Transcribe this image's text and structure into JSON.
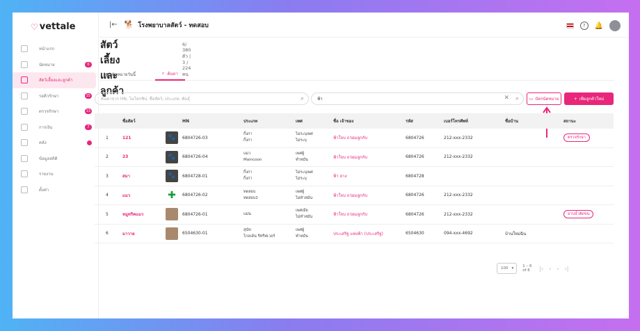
{
  "brand": {
    "name": "vettale"
  },
  "sidebar": {
    "items": [
      {
        "label": "หน้าแรก",
        "badge": ""
      },
      {
        "label": "นัดหมาย",
        "badge": "0"
      },
      {
        "label": "สัตว์เลี้ยงและลูกค้า",
        "badge": ""
      },
      {
        "label": "รอคิวรักษา",
        "badge": "15"
      },
      {
        "label": "ตรวจรักษา",
        "badge": "13"
      },
      {
        "label": "การเงิน",
        "badge": "7"
      },
      {
        "label": "คลัง",
        "badge": "dot"
      },
      {
        "label": "ข้อมูลสถิติ",
        "badge": ""
      },
      {
        "label": "รายงาน",
        "badge": ""
      },
      {
        "label": "ตั้งค่า",
        "badge": ""
      }
    ]
  },
  "topbar": {
    "clinic_name": "โรงพยาบาลสัตว์ - ทดสอบ"
  },
  "page": {
    "title": "สัตว์เลี้ยงและลูกค้า",
    "pet_count": "6/ 380 ตัว",
    "customer_count": "3 / 224 คน"
  },
  "tabs": [
    {
      "label": "นัดหมายวันนี้"
    },
    {
      "label": "ค้นหา"
    }
  ],
  "search": {
    "placeholder": "ค้นหาจาก HN, ไมโครชิป, ชื่อสัตว์, ประเภท, พันธุ์",
    "owner_value": "ฟ้า"
  },
  "buttons": {
    "print": "บัตรนัดหมาย",
    "add": "เพิ่มลูกค้าใหม่"
  },
  "table": {
    "headers": {
      "name": "ชื่อสัตว์",
      "hn": "HN",
      "type": "ประเภท",
      "sex": "เพศ",
      "owner": "ชื่อ เจ้าของ",
      "code": "รหัส",
      "phone": "เบอร์โทรศัพท์",
      "house": "ชื่อบ้าน",
      "status": "สถานะ"
    },
    "rows": [
      {
        "no": "1",
        "name": "121",
        "hn": "6804726-03",
        "type1": "กิ้งก่า",
        "type2": "กิ้งก่า",
        "sex1": "ไม่ระบุเพศ",
        "sex2": "ไม่ระบุ",
        "owner": "ฟ้าใจบ ถว่อมลูกกับ",
        "code": "6804726",
        "phone": "212-xxx-2332",
        "house": "",
        "status": "ตรวจรักษา",
        "img": "paw"
      },
      {
        "no": "2",
        "name": "23",
        "hn": "6804726-04",
        "type1": "แมว",
        "type2": "Maincoon",
        "sex1": "เพศผู้",
        "sex2": "ทำหมัน",
        "owner": "ฟ้าใจบ ถว่อมลูกกับ",
        "code": "6804726",
        "phone": "212-xxx-2332",
        "house": "",
        "status": "",
        "img": "paw"
      },
      {
        "no": "3",
        "name": "สมา",
        "hn": "6804728-01",
        "type1": "กิ้งก่า",
        "type2": "กิ้งก่า",
        "sex1": "ไม่ระบุเพศ",
        "sex2": "ไม่ระบุ",
        "owner": "ฟ้า ลาง",
        "code": "6804728",
        "phone": "",
        "house": "",
        "status": "",
        "img": "paw"
      },
      {
        "no": "4",
        "name": "แมว",
        "hn": "6804726-02",
        "type1": "ทดสอบ",
        "type2": "ทดสอบ2",
        "sex1": "เพศผู้",
        "sex2": "ไม่ทำหมัน",
        "owner": "ฟ้าใจบ ถว่อมลูกกับ",
        "code": "6804726",
        "phone": "212-xxx-2332",
        "house": "",
        "status": "",
        "img": "cross"
      },
      {
        "no": "5",
        "name": "หมูทริคแมว",
        "hn": "6804726-01",
        "type1": "แม่น",
        "type2": "",
        "sex1": "เพศเมีย",
        "sex2": "ไม่ทำหมัน",
        "owner": "ฟ้าใจบ ถว่อมลูกกับ",
        "code": "6804726",
        "phone": "212-xxx-2332",
        "house": "",
        "status": "อาบน้ำตัดขน",
        "img": "photo"
      },
      {
        "no": "6",
        "name": "มาวาย",
        "hn": "6504630-01",
        "type1": "สุนัข",
        "type2": "โกลเด้น รีทรีฟเวอร์",
        "sex1": "เพศผู้",
        "sex2": "ทำหมัน",
        "owner": "ประเสริฐ แท่งฟ้า (ประเสริฐ)",
        "code": "6504630",
        "phone": "094-xxx-4692",
        "house": "บ้านใหม่ฉิน",
        "status": "",
        "img": "photo"
      }
    ]
  },
  "pagination": {
    "per_page": "100",
    "range": "1 – 6 of 6"
  },
  "colors": {
    "accent": "#e8267a"
  }
}
